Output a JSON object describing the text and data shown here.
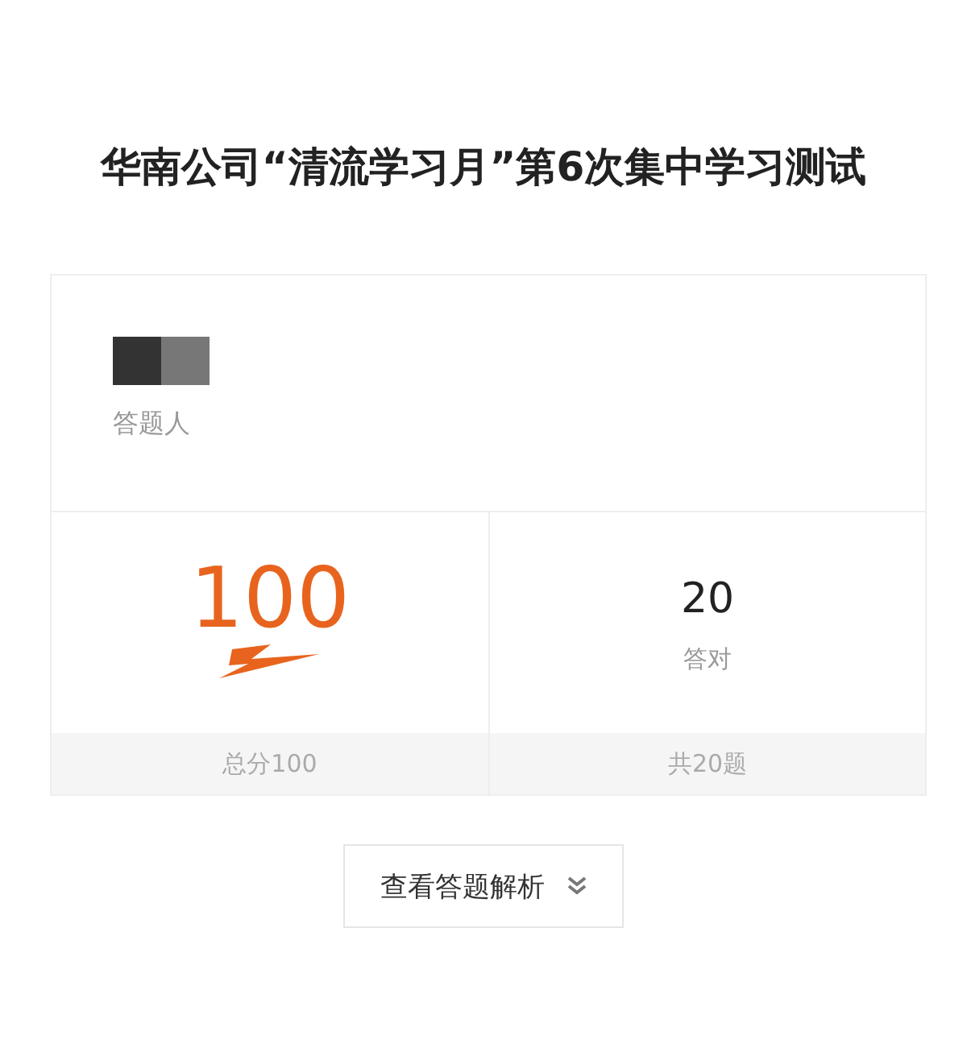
{
  "title": "华南公司“清流学习月”第6次集中学习测试",
  "respondent": {
    "label": "答题人"
  },
  "stats": [
    {
      "kind": "score",
      "value": "100",
      "footer": "总分100"
    },
    {
      "kind": "count",
      "value": "20",
      "label": "答对",
      "footer": "共20题"
    }
  ],
  "analysis_button": {
    "label": "查看答题解析"
  }
}
